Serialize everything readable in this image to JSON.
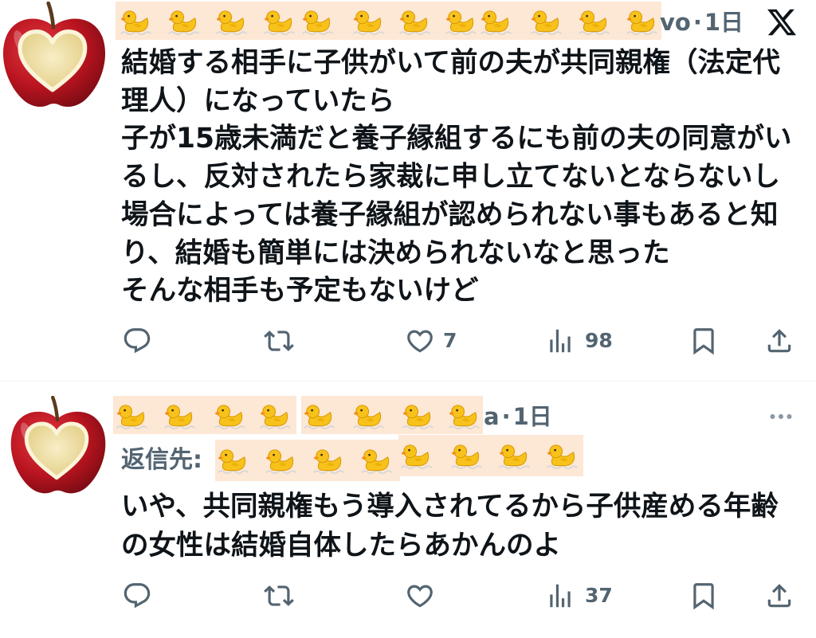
{
  "colors": {
    "text_primary": "#0f1419",
    "text_secondary": "#536471",
    "divider": "#eff3f4",
    "redaction_sticker_bg": "#fde7d5",
    "duck_yellow": "#f8c21c",
    "apple_red": "#c4122a"
  },
  "icons": [
    "x-logo-icon",
    "more-icon",
    "reply-icon",
    "retweet-icon",
    "heart-icon",
    "views-icon",
    "bookmark-icon",
    "share-icon",
    "duck-sticker",
    "apple-avatar"
  ],
  "tweets": [
    {
      "author": {
        "handle_fragment": "vo"
      },
      "separator": "·",
      "time": "1日",
      "lines": [
        "結婚する相手に子供がいて前の夫が共同親権（法定代",
        "理人）になっていたら",
        "子が15歳未満だと養子縁組するにも前の夫の同意がい",
        "るし、反対されたら家裁に申し立てないとならないし",
        "場合によっては養子縁組が認められない事もあると知",
        "り、結婚も簡単には決められないなと思った",
        "そんな相手も予定もないけど"
      ],
      "metrics": {
        "likes": "7",
        "views": "98"
      }
    },
    {
      "author": {
        "handle_fragment": "a"
      },
      "separator": "·",
      "time": "1日",
      "reply_to_label": "返信先:",
      "lines": [
        "いや、共同親権もう導入されてるから子供産める年齢",
        "の女性は結婚自体したらあかんのよ"
      ],
      "metrics": {
        "views": "37"
      }
    }
  ]
}
